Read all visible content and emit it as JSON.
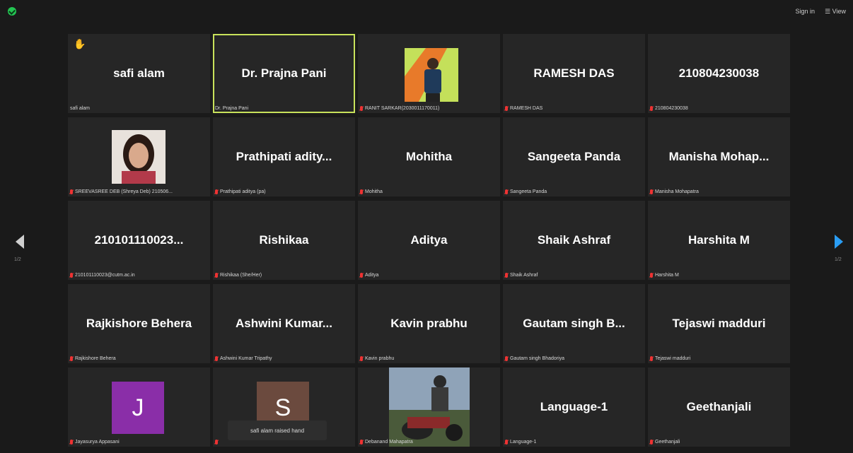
{
  "top": {
    "sign_in": "Sign in",
    "view": "View"
  },
  "toast": "safi alam raised hand",
  "pages": {
    "left": "1/2",
    "right": "1/2"
  },
  "tiles": [
    {
      "big": "safi alam",
      "label": "safi alam",
      "hand": true,
      "active": false,
      "muted": false
    },
    {
      "big": "Dr. Prajna Pani",
      "label": "Dr. Prajna Pani",
      "active": true,
      "muted": false
    },
    {
      "big": "",
      "label": "RANIT SARKAR(2030011170011)",
      "photo": "green",
      "muted": true
    },
    {
      "big": "RAMESH DAS",
      "label": "RAMESH DAS",
      "muted": true
    },
    {
      "big": "210804230038",
      "label": "210804230038",
      "muted": true
    },
    {
      "big": "",
      "label": "SREEVASREE DEB (Shreya Deb) 210506...",
      "photo": "woman",
      "muted": true
    },
    {
      "big": "Prathipati adity...",
      "label": "Prathipati aditya (pa)",
      "muted": true
    },
    {
      "big": "Mohitha",
      "label": "Mohitha",
      "muted": true
    },
    {
      "big": "Sangeeta Panda",
      "label": "Sangeeta Panda",
      "muted": true
    },
    {
      "big": "Manisha Mohap...",
      "label": "Manisha Mohapatra",
      "muted": true
    },
    {
      "big": "210101110023...",
      "label": "210101110023@cutm.ac.in",
      "muted": true
    },
    {
      "big": "Rishikaa",
      "label": "Rishikaa (She/Her)",
      "muted": true
    },
    {
      "big": "Aditya",
      "label": "Aditya",
      "muted": true
    },
    {
      "big": "Shaik Ashraf",
      "label": "Shaik Ashraf",
      "muted": true
    },
    {
      "big": "Harshita M",
      "label": "Harshita M",
      "muted": true
    },
    {
      "big": "Rajkishore Behera",
      "label": "Rajkishore Behera",
      "muted": true
    },
    {
      "big": "Ashwini Kumar...",
      "label": "Ashwini Kumar Tripathy",
      "muted": true
    },
    {
      "big": "Kavin prabhu",
      "label": "Kavin prabhu",
      "muted": true
    },
    {
      "big": "Gautam singh B...",
      "label": "Gautam singh Bhadoriya",
      "muted": true
    },
    {
      "big": "Tejaswi madduri",
      "label": "Tejaswi madduri",
      "muted": true
    },
    {
      "big": "",
      "label": "Jayasurya Appasani",
      "avatar": "J",
      "avatar_color": "#8a2ea8",
      "muted": true
    },
    {
      "big": "",
      "label": "",
      "avatar": "S",
      "avatar_color": "#6b4a3e",
      "muted": true
    },
    {
      "big": "",
      "label": "Debanand Mahapatra",
      "photo": "bike",
      "muted": true
    },
    {
      "big": "Language-1",
      "label": "Language-1",
      "muted": true
    },
    {
      "big": "Geethanjali",
      "label": "Geethanjali",
      "muted": true
    }
  ]
}
